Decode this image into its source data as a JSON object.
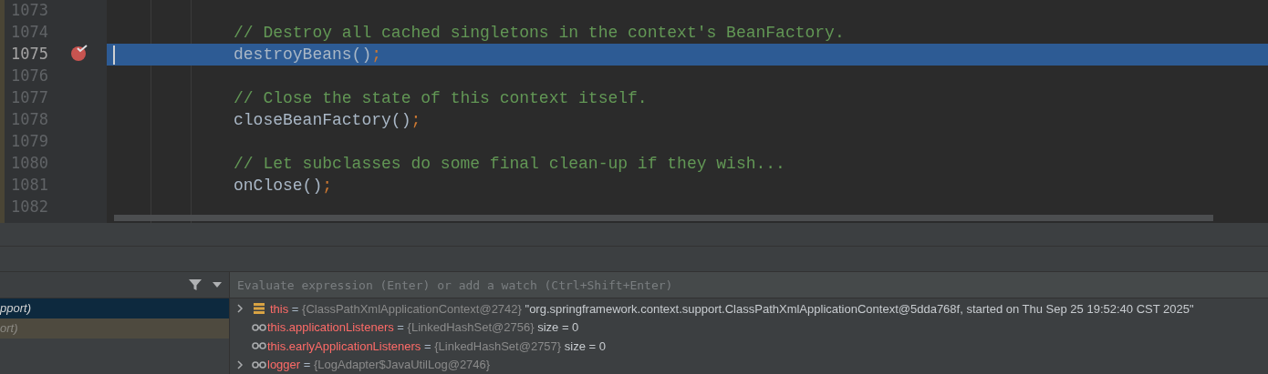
{
  "editor": {
    "lines": [
      {
        "number": "1073",
        "current": false,
        "breakpoint": false
      },
      {
        "number": "1074",
        "current": false,
        "breakpoint": false,
        "code": [
          {
            "kind": "comment",
            "text": "// Destroy all cached singletons in the context's BeanFactory."
          }
        ]
      },
      {
        "number": "1075",
        "current": true,
        "breakpoint": true,
        "code": [
          {
            "kind": "plain",
            "text": "destroyBeans()"
          },
          {
            "kind": "punct",
            "text": ";"
          }
        ]
      },
      {
        "number": "1076",
        "current": false,
        "breakpoint": false
      },
      {
        "number": "1077",
        "current": false,
        "breakpoint": false,
        "code": [
          {
            "kind": "comment",
            "text": "// Close the state of this context itself."
          }
        ]
      },
      {
        "number": "1078",
        "current": false,
        "breakpoint": false,
        "code": [
          {
            "kind": "plain",
            "text": "closeBeanFactory()"
          },
          {
            "kind": "punct",
            "text": ";"
          }
        ]
      },
      {
        "number": "1079",
        "current": false,
        "breakpoint": false
      },
      {
        "number": "1080",
        "current": false,
        "breakpoint": false,
        "code": [
          {
            "kind": "comment",
            "text": "// Let subclasses do some final clean-up if they wish..."
          }
        ]
      },
      {
        "number": "1081",
        "current": false,
        "breakpoint": false,
        "code": [
          {
            "kind": "plain",
            "text": "onClose()"
          },
          {
            "kind": "punct",
            "text": ";"
          }
        ]
      },
      {
        "number": "1082",
        "current": false,
        "breakpoint": false
      }
    ]
  },
  "frames": [
    {
      "text": "pport)",
      "selected": true
    },
    {
      "text": "ort)",
      "selected": false
    }
  ],
  "evaluate": {
    "placeholder": "Evaluate expression (Enter) or add a watch (Ctrl+Shift+Enter)"
  },
  "variables": [
    {
      "expandable": true,
      "kind": "field",
      "name": "this",
      "equals": "=",
      "ref": "{ClassPathXmlApplicationContext@2742}",
      "value": "\"org.springframework.context.support.ClassPathXmlApplicationContext@5dda768f, started on Thu Sep 25 19:52:40 CST 2025\""
    },
    {
      "expandable": false,
      "kind": "watch",
      "name": "this.applicationListeners",
      "equals": "=",
      "ref": "{LinkedHashSet@2756}",
      "value": "size = 0"
    },
    {
      "expandable": false,
      "kind": "watch",
      "name": "this.earlyApplicationListeners",
      "equals": "=",
      "ref": "{LinkedHashSet@2757}",
      "value": "size = 0"
    },
    {
      "expandable": true,
      "kind": "watch",
      "name": "logger",
      "equals": "=",
      "ref": "{LogAdapter$JavaUtilLog@2746}"
    }
  ]
}
